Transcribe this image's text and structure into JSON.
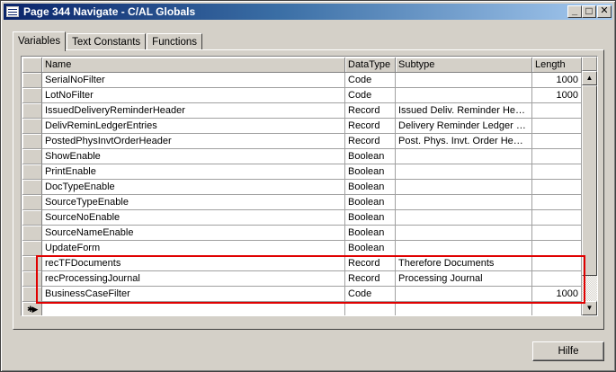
{
  "window": {
    "title": "Page 344 Navigate - C/AL Globals",
    "controls": {
      "minimize": "_",
      "maximize": "□",
      "close": "✕"
    }
  },
  "tabs": [
    {
      "label": "Variables",
      "active": true
    },
    {
      "label": "Text Constants",
      "active": false
    },
    {
      "label": "Functions",
      "active": false
    }
  ],
  "grid": {
    "columns": [
      "Name",
      "DataType",
      "Subtype",
      "Length"
    ],
    "rows": [
      {
        "name": "SerialNoFilter",
        "datatype": "Code",
        "subtype": "",
        "length": "1000"
      },
      {
        "name": "LotNoFilter",
        "datatype": "Code",
        "subtype": "",
        "length": "1000"
      },
      {
        "name": "IssuedDeliveryReminderHeader",
        "datatype": "Record",
        "subtype": "Issued Deliv. Reminder Hea…",
        "length": ""
      },
      {
        "name": "DelivReminLedgerEntries",
        "datatype": "Record",
        "subtype": "Delivery Reminder Ledger E…",
        "length": ""
      },
      {
        "name": "PostedPhysInvtOrderHeader",
        "datatype": "Record",
        "subtype": "Post. Phys. Invt. Order He…",
        "length": ""
      },
      {
        "name": "ShowEnable",
        "datatype": "Boolean",
        "subtype": "",
        "length": ""
      },
      {
        "name": "PrintEnable",
        "datatype": "Boolean",
        "subtype": "",
        "length": ""
      },
      {
        "name": "DocTypeEnable",
        "datatype": "Boolean",
        "subtype": "",
        "length": ""
      },
      {
        "name": "SourceTypeEnable",
        "datatype": "Boolean",
        "subtype": "",
        "length": ""
      },
      {
        "name": "SourceNoEnable",
        "datatype": "Boolean",
        "subtype": "",
        "length": ""
      },
      {
        "name": "SourceNameEnable",
        "datatype": "Boolean",
        "subtype": "",
        "length": ""
      },
      {
        "name": "UpdateForm",
        "datatype": "Boolean",
        "subtype": "",
        "length": ""
      },
      {
        "name": "recTFDocuments",
        "datatype": "Record",
        "subtype": "Therefore Documents",
        "length": ""
      },
      {
        "name": "recProcessingJournal",
        "datatype": "Record",
        "subtype": "Processing Journal",
        "length": ""
      },
      {
        "name": "BusinessCaseFilter",
        "datatype": "Code",
        "subtype": "",
        "length": "1000"
      }
    ],
    "new_row_marker": "✱▶"
  },
  "scrollbar": {
    "up": "▲",
    "down": "▼"
  },
  "buttons": {
    "help": "Hilfe"
  },
  "colors": {
    "highlight": "#e00000",
    "titlebar": "#0a246a"
  }
}
